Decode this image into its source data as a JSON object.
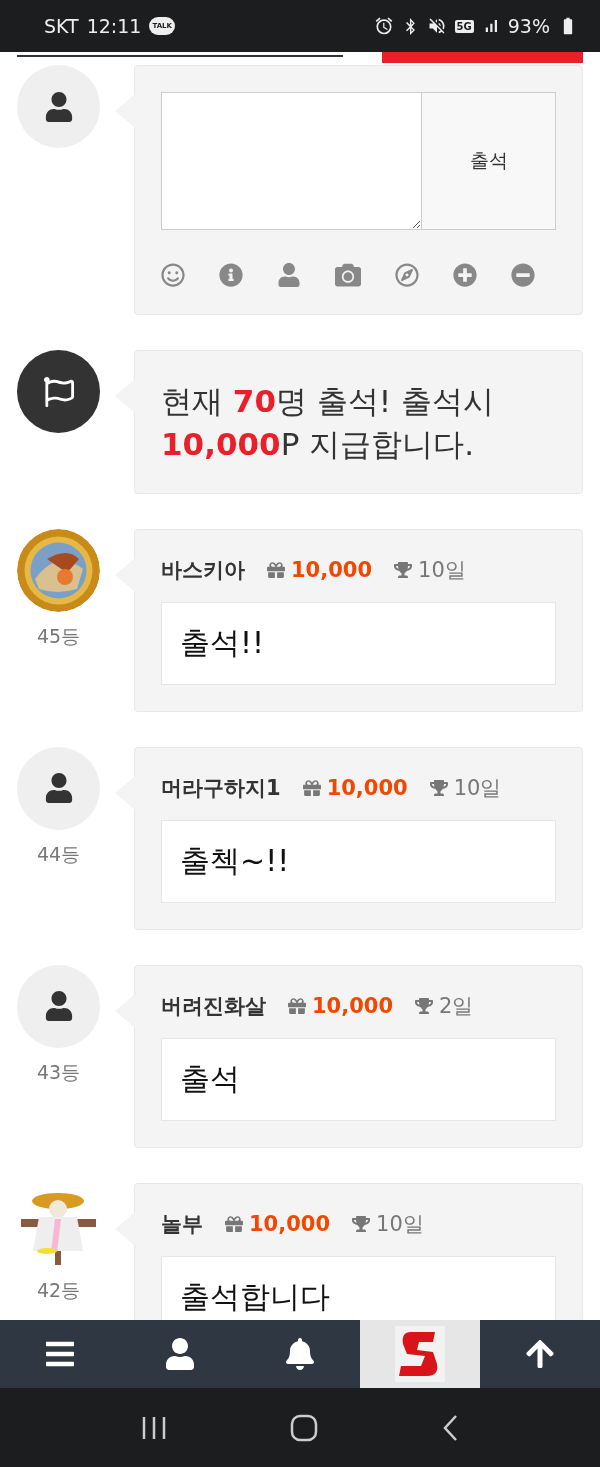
{
  "status_bar": {
    "carrier": "SKT",
    "time": "12:11",
    "chat_badge": "TALK",
    "network": "5G",
    "battery": "93%"
  },
  "write_form": {
    "submit": "출석"
  },
  "notice": {
    "text": "현재 **70**명 출석! 출석시 **10,000**P 지급합니다."
  },
  "entries": [
    {
      "photo": true,
      "rank": "45등",
      "name": "바스키아",
      "points": "10,000",
      "days": "10일",
      "message": "출석!!"
    },
    {
      "photo": false,
      "rank": "44등",
      "name": "머라구하지1",
      "points": "10,000",
      "days": "10일",
      "message": "출첵~!!"
    },
    {
      "photo": false,
      "rank": "43등",
      "name": "버려진화살",
      "points": "10,000",
      "days": "2일",
      "message": "출석"
    },
    {
      "photo": true,
      "rank": "42등",
      "name": "놀부",
      "points": "10,000",
      "days": "10일",
      "message": "출석합니다"
    }
  ]
}
